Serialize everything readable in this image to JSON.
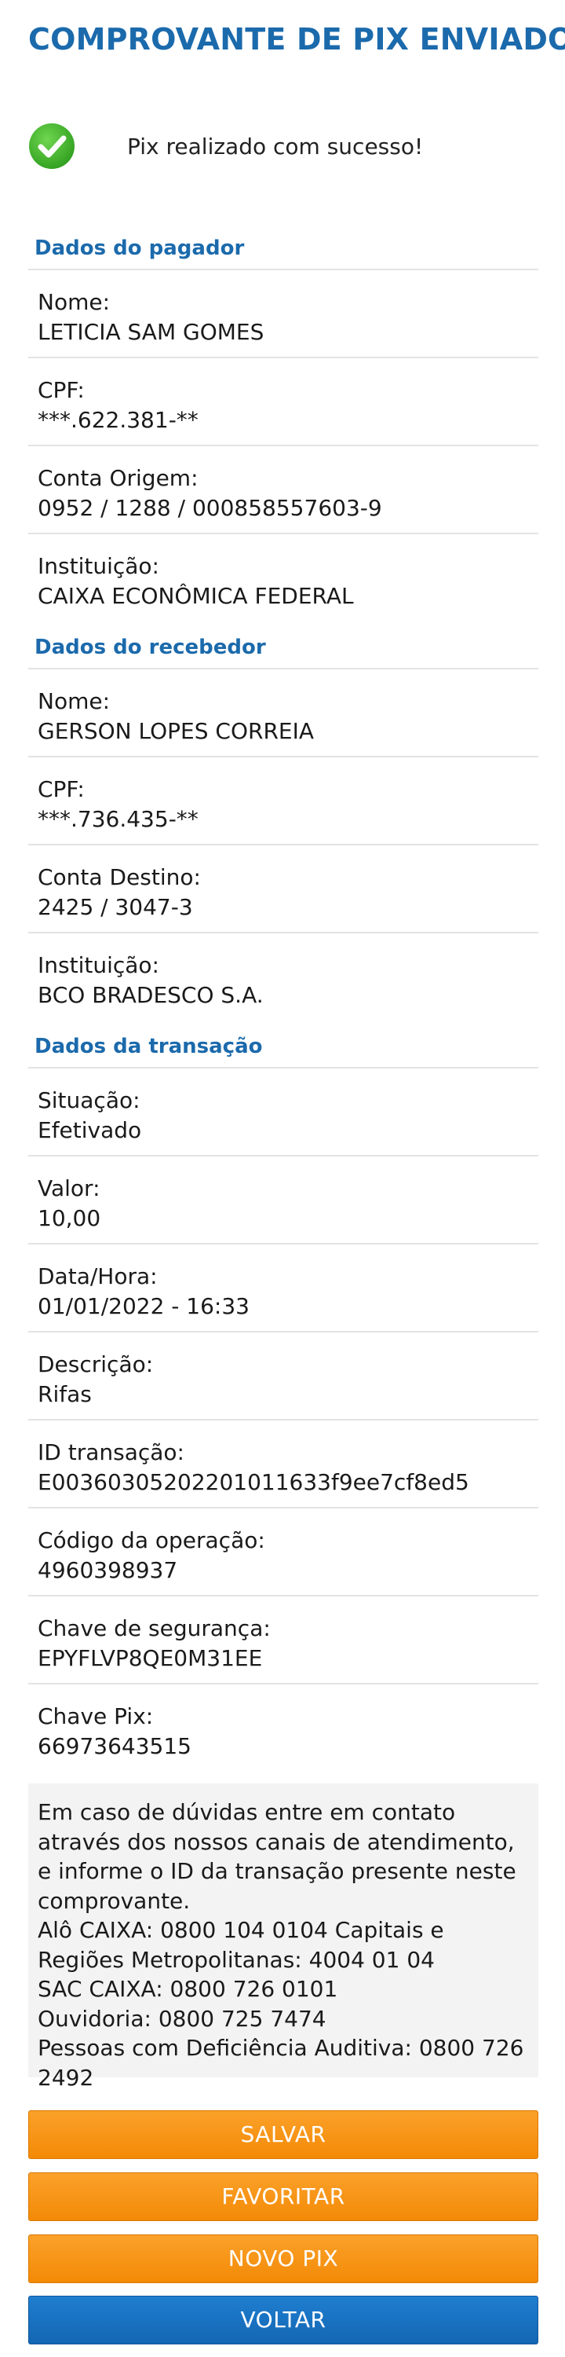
{
  "header": {
    "title": "COMPROVANTE DE PIX ENVIADO"
  },
  "status": {
    "message": "Pix realizado com sucesso!",
    "icon": "check-circle-icon",
    "icon_color": "#3cb82b"
  },
  "pagador": {
    "title": "Dados do pagador",
    "fields": [
      {
        "label": "Nome:",
        "value": "LETICIA SAM GOMES"
      },
      {
        "label": "CPF:",
        "value": "***.622.381-**"
      },
      {
        "label": "Conta Origem:",
        "value": "0952 / 1288 / 000858557603-9"
      },
      {
        "label": "Instituição:",
        "value": "CAIXA ECONÔMICA FEDERAL"
      }
    ]
  },
  "recebedor": {
    "title": "Dados do recebedor",
    "fields": [
      {
        "label": "Nome:",
        "value": "GERSON LOPES CORREIA"
      },
      {
        "label": "CPF:",
        "value": "***.736.435-**"
      },
      {
        "label": "Conta Destino:",
        "value": "2425 / 3047-3"
      },
      {
        "label": "Instituição:",
        "value": "BCO BRADESCO S.A."
      }
    ]
  },
  "transacao": {
    "title": "Dados da transação",
    "fields": [
      {
        "label": "Situação:",
        "value": "Efetivado"
      },
      {
        "label": "Valor:",
        "value": "10,00"
      },
      {
        "label": "Data/Hora:",
        "value": "01/01/2022 - 16:33"
      },
      {
        "label": "Descrição:",
        "value": "Rifas"
      },
      {
        "label": "ID transação:",
        "value": "E00360305202201011633f9ee7cf8ed5"
      },
      {
        "label": "Código da operação:",
        "value": "4960398937"
      },
      {
        "label": "Chave de segurança:",
        "value": "EPYFLVP8QE0M31EE"
      },
      {
        "label": "Chave Pix:",
        "value": "66973643515"
      }
    ]
  },
  "info": {
    "text": "Em caso de dúvidas entre em contato através dos nossos canais de atendimento, e informe o ID da transação presente neste comprovante.",
    "lines": [
      "Alô CAIXA: 0800 104 0104 Capitais e Regiões Metropolitanas: 4004 01 04",
      "SAC CAIXA: 0800 726 0101",
      "Ouvidoria: 0800 725 7474",
      "Pessoas com Deficiência Auditiva: 0800 726 2492"
    ]
  },
  "buttons": {
    "salvar": "SALVAR",
    "favoritar": "FAVORITAR",
    "novo_pix": "NOVO PIX",
    "voltar": "VOLTAR"
  },
  "colors": {
    "brand_blue": "#1b6aac",
    "button_orange": "#f7941d",
    "button_blue": "#1771c2"
  }
}
